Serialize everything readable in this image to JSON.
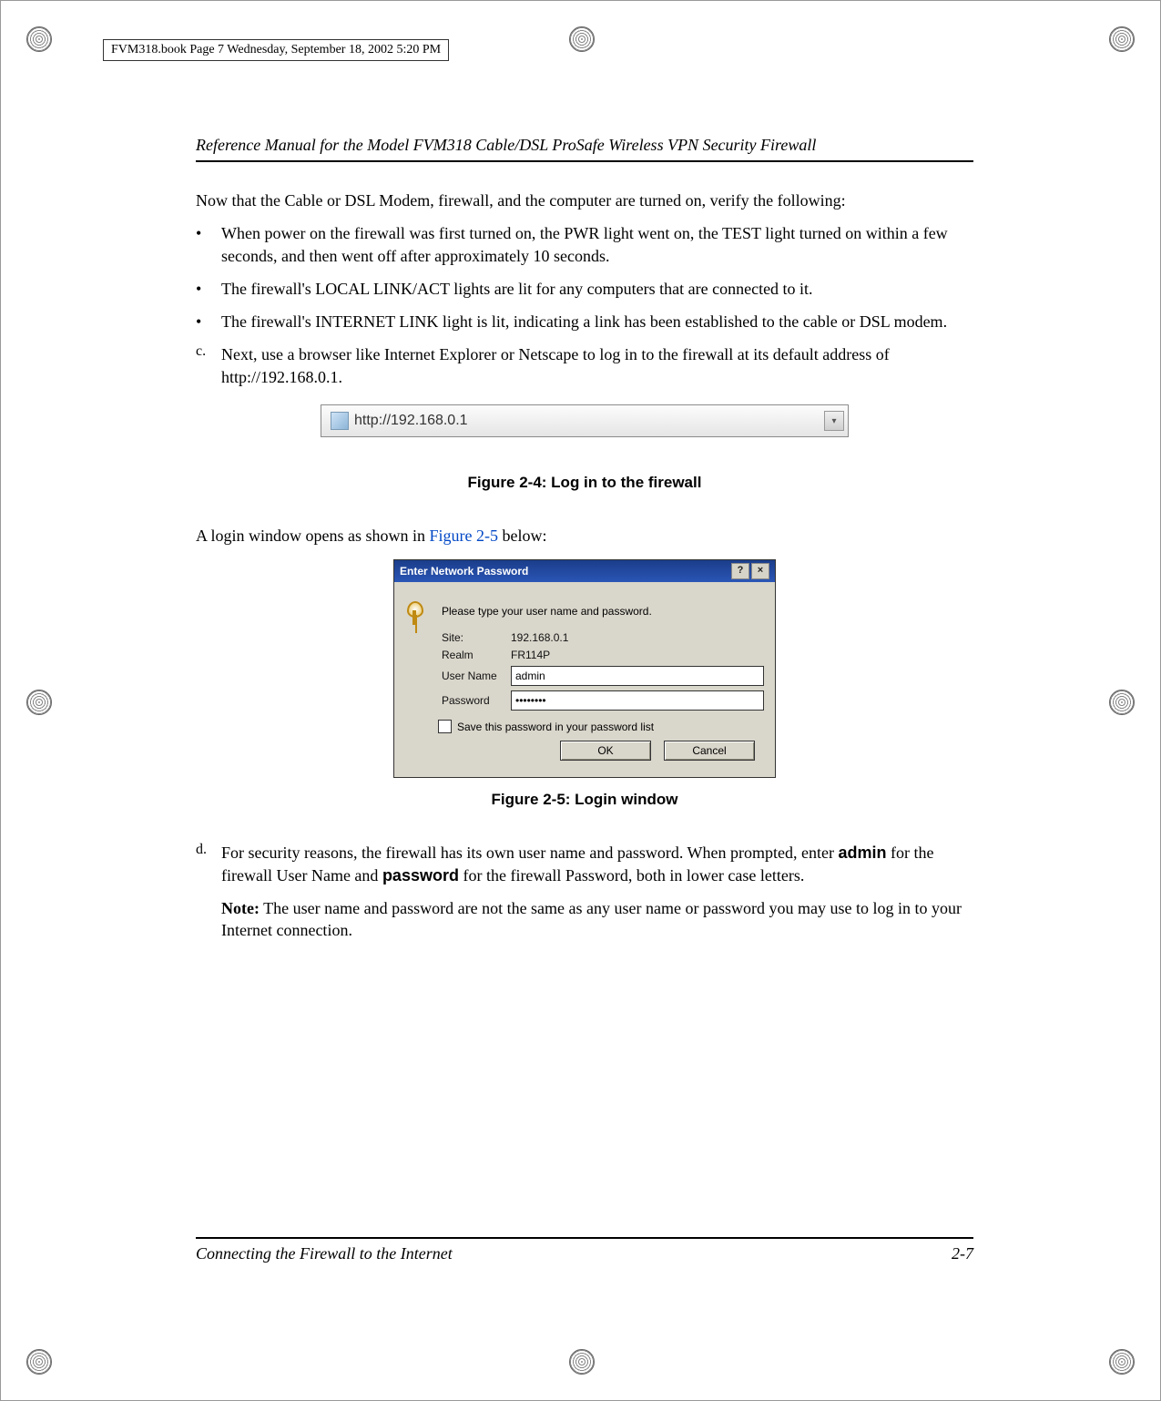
{
  "bookTag": "FVM318.book  Page 7  Wednesday, September 18, 2002  5:20 PM",
  "headerTitle": "Reference Manual for the Model FVM318 Cable/DSL ProSafe Wireless VPN Security Firewall",
  "intro": "Now that the Cable or DSL Modem, firewall, and the computer are turned on, verify the following:",
  "bullets": [
    "When power on the firewall was first turned on, the PWR light went on, the TEST light turned on within a few seconds, and then went off after approximately 10 seconds.",
    "The firewall's LOCAL LINK/ACT lights are lit for any computers that are connected to it.",
    "The firewall's INTERNET LINK light is lit, indicating a link has been established to the cable or DSL modem."
  ],
  "stepC": {
    "label": "c.",
    "text": "Next, use a browser like Internet Explorer or Netscape to log in to the firewall at its default address of http://192.168.0.1."
  },
  "addrUrl": "http://192.168.0.1",
  "caption24": "Figure 2-4: Log in to the firewall",
  "loginIntro": {
    "pre": "A login window opens as shown in ",
    "link": "Figure 2-5",
    "post": " below:"
  },
  "login": {
    "title": "Enter Network Password",
    "prompt": "Please type your user name and password.",
    "siteLabel": "Site:",
    "siteValue": "192.168.0.1",
    "realmLabel": "Realm",
    "realmValue": "FR114P",
    "userLabel": "User Name",
    "userValue": "admin",
    "passLabel": "Password",
    "passValue": "xxxxxxxx",
    "saveLabel": "Save this password in your password list",
    "ok": "OK",
    "cancel": "Cancel",
    "help": "?",
    "close": "×"
  },
  "caption25": "Figure 2-5: Login window",
  "stepD": {
    "label": "d.",
    "pre": "For security reasons, the firewall has its own user name and password. When prompted, enter ",
    "admin": "admin",
    "mid": " for the firewall User Name and ",
    "password": "password",
    "post": " for the firewall Password, both in lower case letters.",
    "noteLabel": "Note:",
    "noteText": " The user name and password are not the same as any user name or password you may use to log in to your Internet connection."
  },
  "footer": {
    "left": "Connecting the Firewall to the Internet",
    "right": "2-7"
  }
}
